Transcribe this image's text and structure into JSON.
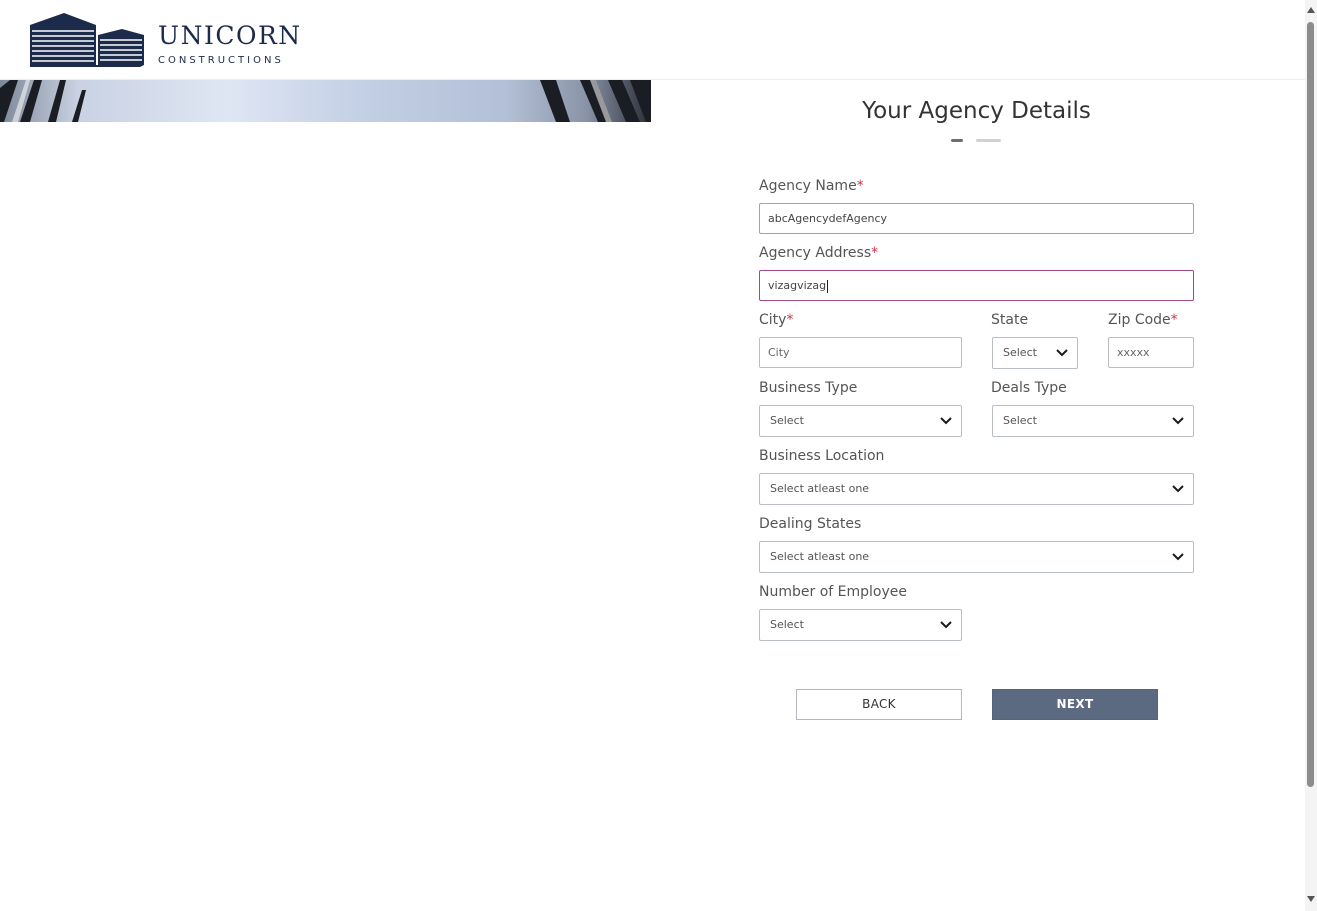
{
  "brand": {
    "name": "UNICORN",
    "subtitle": "CONSTRUCTIONS"
  },
  "form": {
    "title": "Your Agency Details",
    "agency_name": {
      "label": "Agency Name",
      "required": "*",
      "value": "abcAgencydefAgency"
    },
    "agency_address": {
      "label": "Agency Address",
      "required": "*",
      "value": "vizagvizag"
    },
    "city": {
      "label": "City",
      "required": "*",
      "placeholder": "City"
    },
    "state": {
      "label": "State",
      "value": "Select"
    },
    "zip": {
      "label": "Zip Code",
      "required": "*",
      "placeholder": "xxxxx"
    },
    "business_type": {
      "label": "Business Type",
      "value": "Select"
    },
    "deals_type": {
      "label": "Deals Type",
      "value": "Select"
    },
    "business_location": {
      "label": "Business Location",
      "value": "Select atleast one"
    },
    "dealing_states": {
      "label": "Dealing States",
      "value": "Select atleast one"
    },
    "num_employee": {
      "label": "Number of Employee",
      "value": "Select"
    }
  },
  "buttons": {
    "back": "BACK",
    "next": "NEXT"
  },
  "colors": {
    "brand_navy": "#1d2b4b",
    "next_button": "#5b6a80",
    "required": "#d0344c"
  }
}
